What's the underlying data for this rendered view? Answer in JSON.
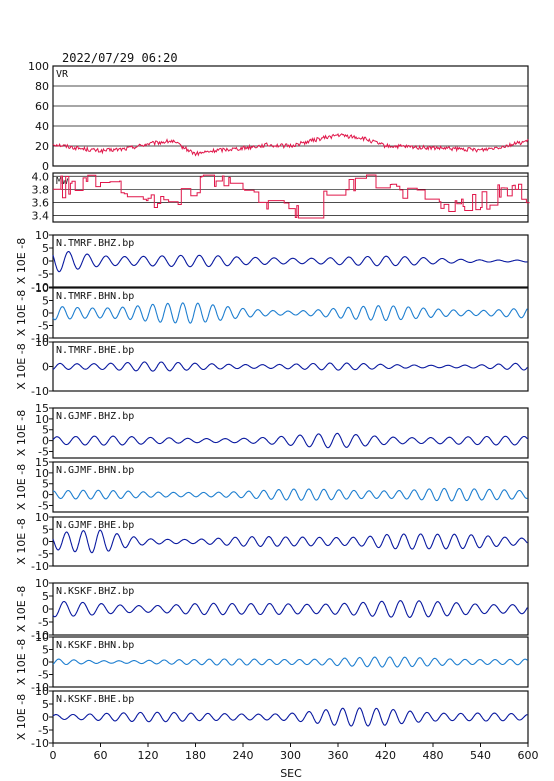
{
  "header": {
    "timestamp": "2022/07/29 06:20"
  },
  "colors": {
    "vr": "#e0174a",
    "mw": "#e0174a",
    "dark_wave": "#0a1aa0",
    "light_wave": "#1f7fd0"
  },
  "chart_data": {
    "type": "line",
    "xlabel": "SEC",
    "xlim": [
      0,
      600
    ],
    "xticks": [
      0,
      60,
      120,
      180,
      240,
      300,
      360,
      420,
      480,
      540,
      600
    ],
    "grid": "horizontal lines on VR and Mw panels only",
    "ylabel_note": "X 10E -8",
    "panels": [
      {
        "label": "VR",
        "ylim": [
          0,
          100
        ],
        "yticks": [
          0,
          20,
          40,
          60,
          80,
          100
        ],
        "x": [
          0,
          30,
          60,
          90,
          120,
          150,
          180,
          210,
          240,
          270,
          300,
          330,
          360,
          390,
          420,
          450,
          480,
          510,
          540,
          570,
          600
        ],
        "values": [
          22,
          18,
          15,
          17,
          22,
          25,
          12,
          16,
          18,
          21,
          20,
          26,
          31,
          28,
          20,
          19,
          18,
          17,
          16,
          20,
          25
        ]
      },
      {
        "label": "Mw",
        "ylim": [
          3.3,
          4.05
        ],
        "yticks": [
          "3.4",
          "3.6",
          "3.8",
          "4.0"
        ],
        "x": [
          0,
          30,
          60,
          90,
          120,
          150,
          180,
          210,
          240,
          270,
          300,
          330,
          360,
          390,
          420,
          450,
          480,
          510,
          540,
          570,
          600
        ],
        "values": [
          3.8,
          3.9,
          3.8,
          3.75,
          3.7,
          3.65,
          3.9,
          3.95,
          3.7,
          3.55,
          3.5,
          3.6,
          3.7,
          4.0,
          3.95,
          3.7,
          3.55,
          3.5,
          3.6,
          3.85,
          3.65
        ]
      },
      {
        "label": "N.TMRF.BHZ.bp",
        "ylim": [
          -10,
          10
        ],
        "yticks": [
          "-10",
          "-5",
          "0",
          "5",
          "10"
        ],
        "color": "dark",
        "x": [
          0,
          60,
          120,
          180,
          240,
          300,
          360,
          420,
          480,
          540,
          600
        ],
        "amplitude": [
          4.5,
          3.2,
          3.5,
          2.5,
          1.5,
          1.8,
          2.5,
          2.0,
          1.2,
          0.8,
          0.6
        ]
      },
      {
        "label": "N.TMRF.BHN.bp",
        "ylim": [
          -10,
          10
        ],
        "yticks": [
          "-10",
          "-5",
          "0",
          "5",
          "10"
        ],
        "color": "light",
        "x": [
          0,
          60,
          120,
          180,
          240,
          300,
          360,
          420,
          480,
          540,
          600
        ],
        "amplitude": [
          3.5,
          4.0,
          4.5,
          4.0,
          2.5,
          1.5,
          2.5,
          3.0,
          2.5,
          2.0,
          2.5
        ]
      },
      {
        "label": "N.TMRF.BHE.bp",
        "ylim": [
          -10,
          10
        ],
        "yticks": [
          "-10",
          "0",
          "10"
        ],
        "color": "dark",
        "x": [
          0,
          60,
          120,
          180,
          240,
          300,
          360,
          420,
          480,
          540,
          600
        ],
        "amplitude": [
          2.5,
          2.0,
          2.0,
          1.5,
          1.5,
          1.5,
          1.5,
          1.0,
          1.0,
          1.0,
          1.5
        ]
      },
      {
        "label": "N.GJMF.BHZ.bp",
        "ylim": [
          -8,
          15
        ],
        "yticks": [
          "-5",
          "0",
          "5",
          "10",
          "15"
        ],
        "color": "dark",
        "x": [
          0,
          60,
          120,
          180,
          240,
          300,
          360,
          420,
          480,
          540,
          600
        ],
        "amplitude": [
          3.5,
          2.5,
          1.5,
          1.5,
          2.0,
          2.5,
          3.5,
          3.0,
          2.5,
          2.0,
          2.0
        ]
      },
      {
        "label": "N.GJMF.BHN.bp",
        "ylim": [
          -8,
          15
        ],
        "yticks": [
          "-5",
          "0",
          "5",
          "10",
          "15"
        ],
        "color": "light",
        "x": [
          0,
          60,
          120,
          180,
          240,
          300,
          360,
          420,
          480,
          540,
          600
        ],
        "amplitude": [
          2.5,
          2.0,
          1.5,
          2.0,
          2.0,
          2.5,
          3.0,
          3.5,
          3.5,
          2.5,
          2.5
        ]
      },
      {
        "label": "N.GJMF.BHE.bp",
        "ylim": [
          -10,
          10
        ],
        "yticks": [
          "-10",
          "-5",
          "0",
          "5",
          "10"
        ],
        "color": "dark",
        "x": [
          0,
          60,
          120,
          180,
          240,
          300,
          360,
          420,
          480,
          540,
          600
        ],
        "amplitude": [
          3.5,
          5.0,
          2.0,
          1.5,
          2.0,
          2.0,
          3.0,
          4.5,
          3.0,
          3.0,
          2.5
        ]
      },
      {
        "label": "N.KSKF.BHZ.bp",
        "ylim": [
          -10,
          10
        ],
        "yticks": [
          "-10",
          "-5",
          "0",
          "5",
          "10"
        ],
        "color": "dark",
        "x": [
          0,
          60,
          120,
          180,
          240,
          300,
          360,
          420,
          480,
          540,
          600
        ],
        "amplitude": [
          3.0,
          3.0,
          2.5,
          2.5,
          2.0,
          3.0,
          4.0,
          3.5,
          3.0,
          3.0,
          3.5
        ]
      },
      {
        "label": "N.KSKF.BHN.bp",
        "ylim": [
          -10,
          10
        ],
        "yticks": [
          "-10",
          "-5",
          "0",
          "5",
          "10"
        ],
        "color": "light",
        "x": [
          0,
          60,
          120,
          180,
          240,
          300,
          360,
          420,
          480,
          540,
          600
        ],
        "amplitude": [
          1.5,
          1.0,
          1.0,
          1.0,
          1.5,
          2.0,
          2.0,
          2.0,
          2.0,
          2.0,
          1.5
        ]
      },
      {
        "label": "N.KSKF.BHE.bp",
        "ylim": [
          -10,
          10
        ],
        "yticks": [
          "-10",
          "-5",
          "0",
          "5",
          "10"
        ],
        "color": "dark",
        "x": [
          0,
          60,
          120,
          180,
          240,
          300,
          360,
          420,
          480,
          540,
          600
        ],
        "amplitude": [
          1.5,
          2.5,
          2.0,
          1.5,
          2.0,
          2.5,
          3.5,
          3.5,
          3.0,
          2.5,
          1.0
        ]
      }
    ]
  }
}
